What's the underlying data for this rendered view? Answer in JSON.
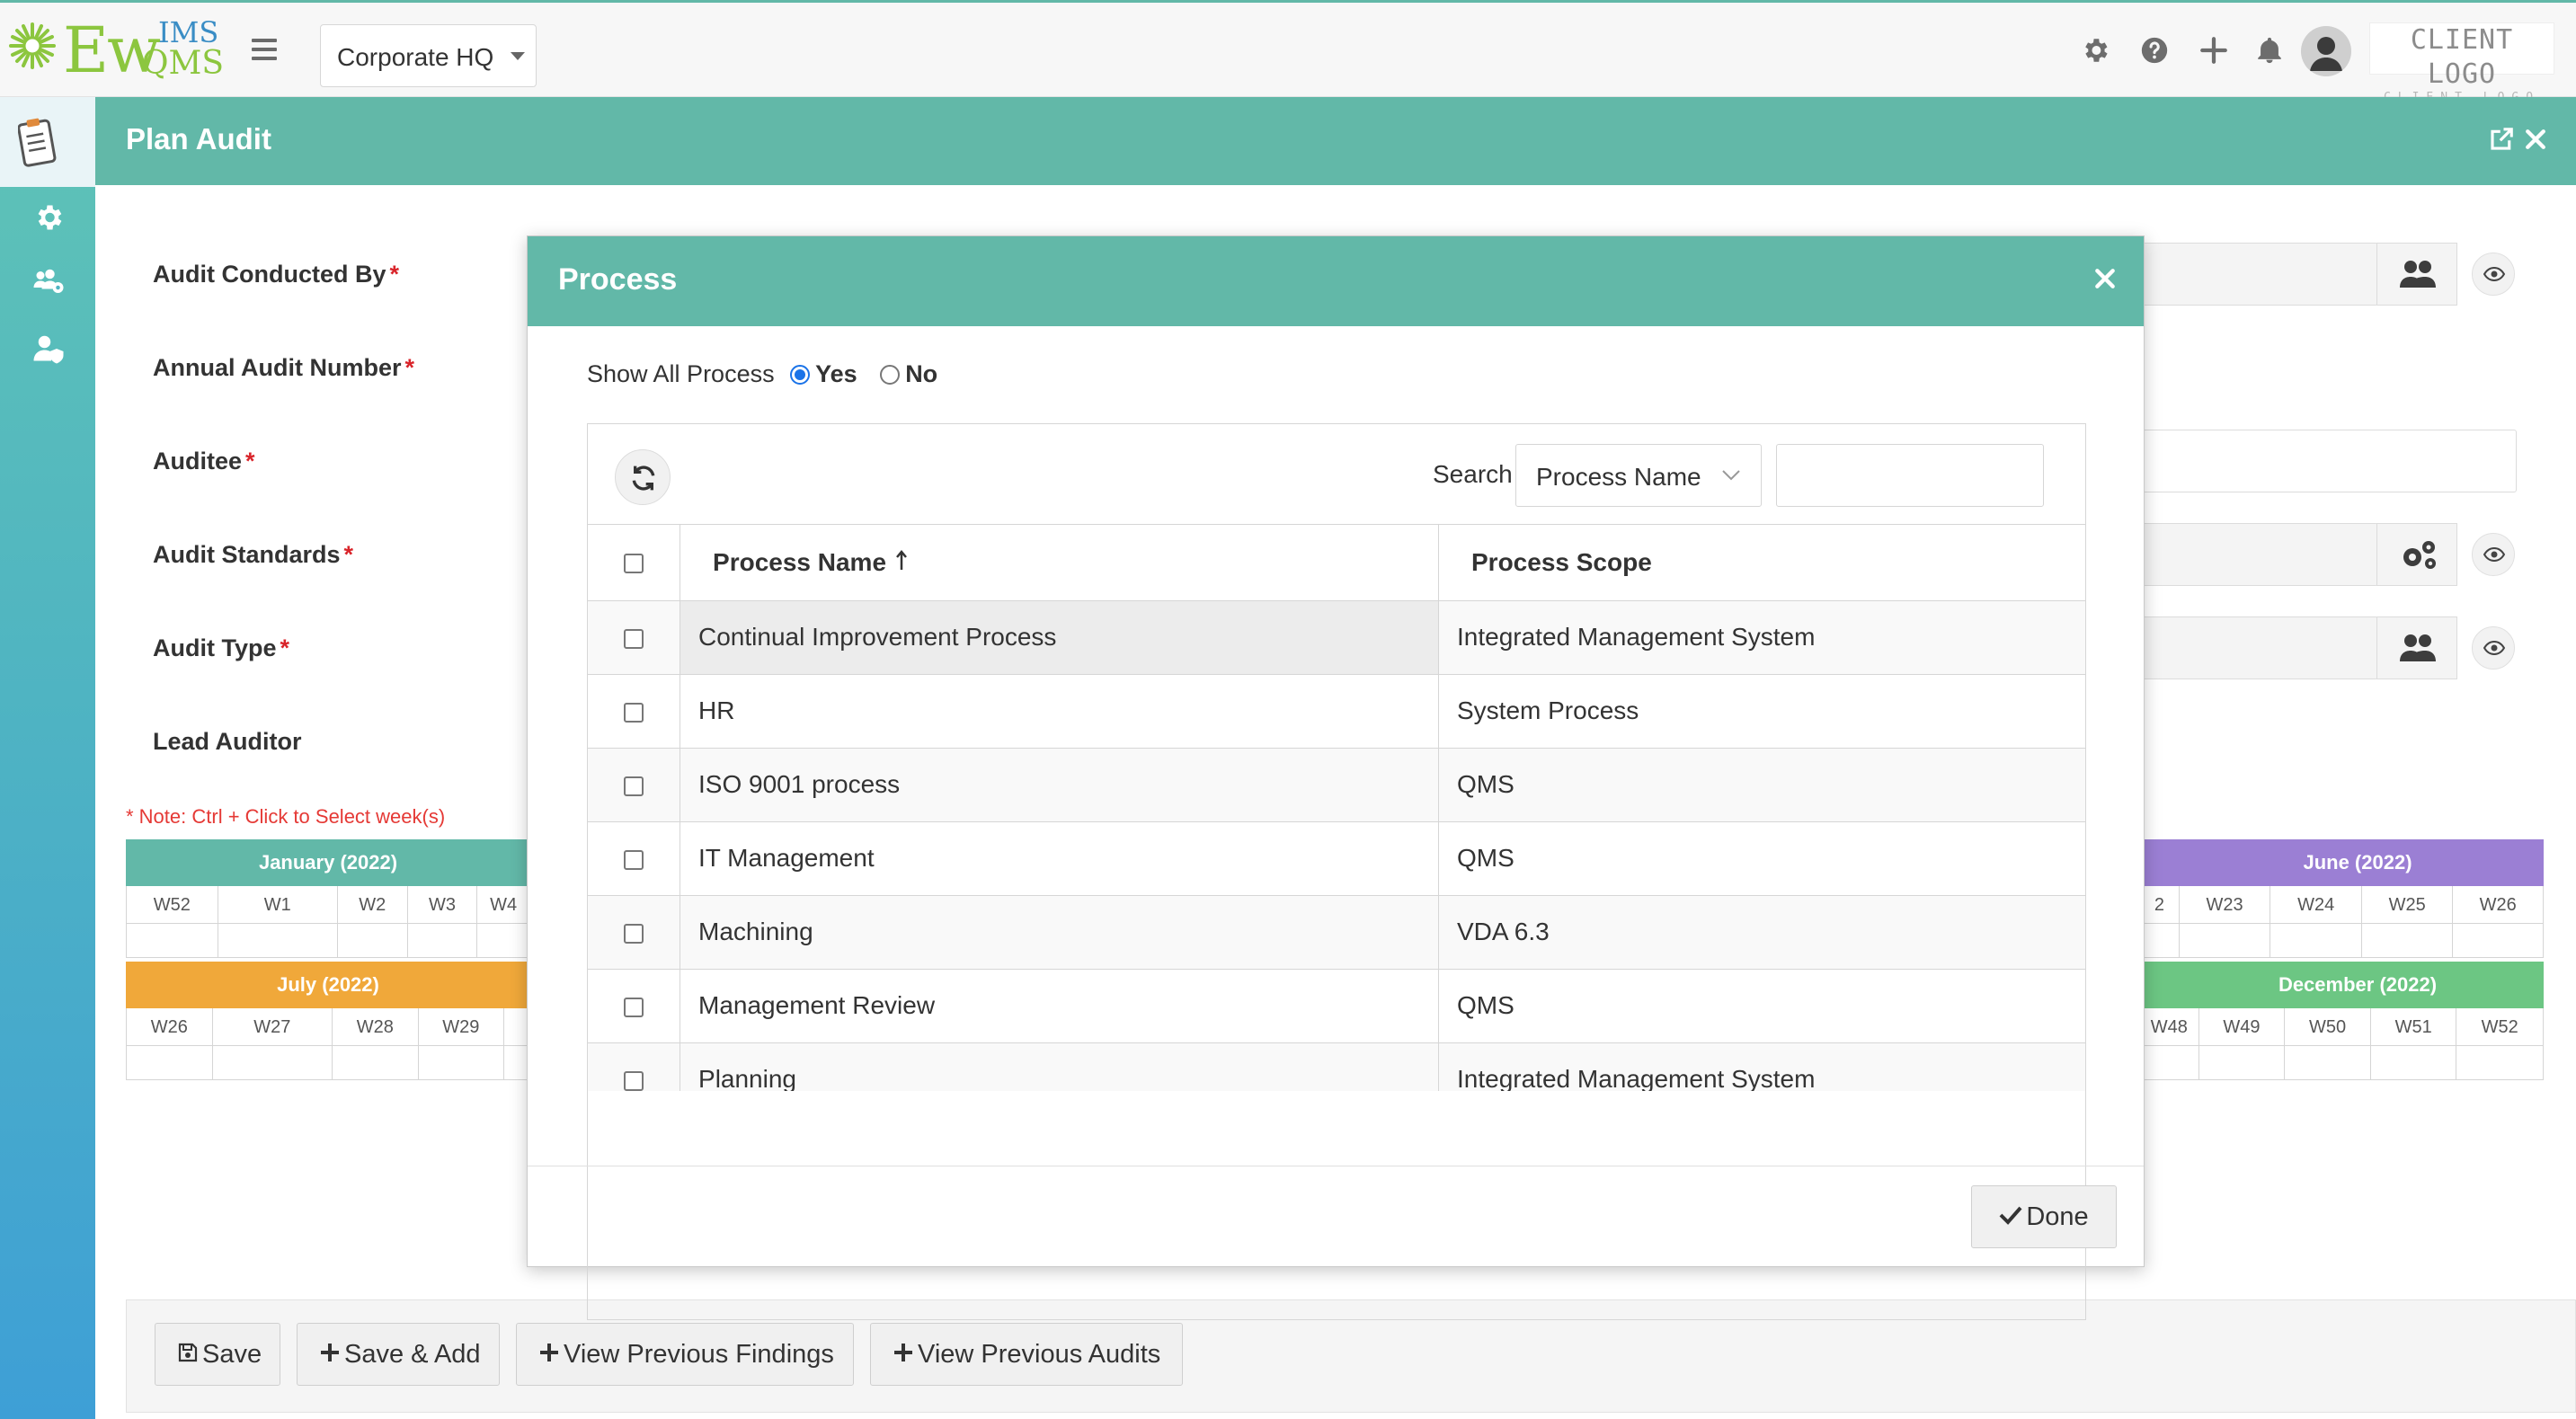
{
  "app": {
    "logo_main": "Ew",
    "logo_ims": "IMS",
    "logo_qms": "QMS",
    "site": "Corporate HQ",
    "client_logo_main": "CLIENT LOGO",
    "client_logo_sub": "CLIENT LOGO",
    "accent": "#62b8a8"
  },
  "page": {
    "title": "Plan Audit"
  },
  "form": {
    "fields": [
      {
        "label": "Audit Conducted By",
        "required": "*"
      },
      {
        "label": "Annual Audit Number",
        "required": "*"
      },
      {
        "label": "Auditee",
        "required": "*"
      },
      {
        "label": "Audit Standards",
        "required": "*"
      },
      {
        "label": "Audit Type",
        "required": "*"
      },
      {
        "label": "Lead Auditor",
        "required": ""
      }
    ],
    "note": "* Note: Ctrl + Click to Select week(s)"
  },
  "calendar": {
    "left": [
      {
        "month": "January (2022)",
        "color": "#62b8a8",
        "weeks": [
          "W52",
          "W1",
          "W2",
          "W3",
          "W4"
        ]
      },
      {
        "month": "July (2022)",
        "color": "#f0a83a",
        "weeks": [
          "W26",
          "W27",
          "W28",
          "W29",
          ""
        ]
      }
    ],
    "right": [
      {
        "month": "June (2022)",
        "color": "#9b7fd4",
        "weeks": [
          "2",
          "W23",
          "W24",
          "W25",
          "W26"
        ]
      },
      {
        "month": "December (2022)",
        "color": "#6cc683",
        "weeks": [
          "W48",
          "W49",
          "W50",
          "W51",
          "W52"
        ]
      }
    ]
  },
  "buttons": {
    "save": "Save",
    "save_add": "Save & Add",
    "view_findings": "View Previous Findings",
    "view_audits": "View Previous Audits"
  },
  "modal": {
    "title": "Process",
    "show_all_label": "Show All Process",
    "yes": "Yes",
    "no": "No",
    "search_label": "Search",
    "search_field": "Process Name",
    "search_value": "",
    "columns": [
      "Process Name",
      "Process Scope"
    ],
    "rows": [
      {
        "name": "Continual Improvement Process",
        "scope": "Integrated Management System"
      },
      {
        "name": "HR",
        "scope": "System Process"
      },
      {
        "name": "ISO 9001 process",
        "scope": "QMS"
      },
      {
        "name": "IT Management",
        "scope": "QMS"
      },
      {
        "name": "Machining",
        "scope": "VDA 6.3"
      },
      {
        "name": "Management Review",
        "scope": "QMS"
      },
      {
        "name": "Planning",
        "scope": "Integrated Management System"
      }
    ],
    "done": "Done"
  }
}
